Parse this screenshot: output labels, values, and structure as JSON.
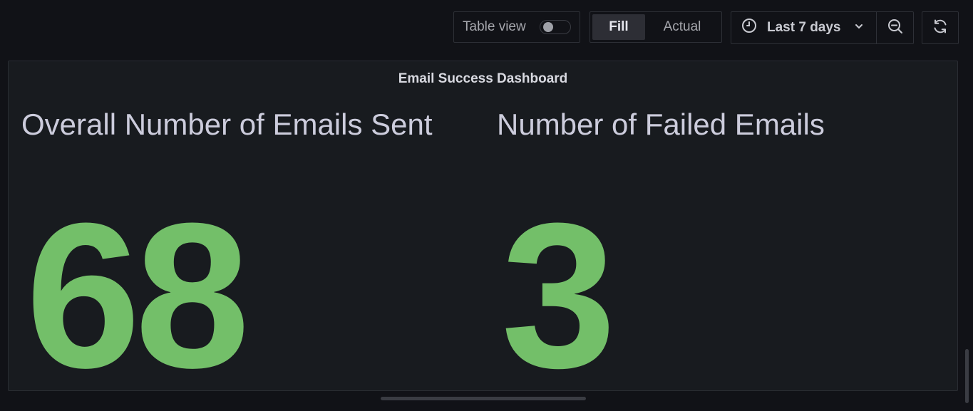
{
  "toolbar": {
    "table_view_label": "Table view",
    "table_view_on": false,
    "view_modes": [
      "Fill",
      "Actual"
    ],
    "active_view_mode": "Fill",
    "time_range_label": "Last 7 days",
    "icons": {
      "clock": "clock-icon",
      "chevron": "chevron-down-icon",
      "zoom_out": "zoom-out-icon",
      "refresh": "refresh-icon"
    }
  },
  "panel": {
    "title": "Email Success Dashboard",
    "stats": [
      {
        "title": "Overall Number of Emails Sent",
        "value": "68"
      },
      {
        "title": "Number of Failed Emails",
        "value": "3"
      }
    ]
  },
  "colors": {
    "background": "#111217",
    "panel": "#181b1f",
    "stat_value": "#73bf69",
    "text": "#ccccdc"
  }
}
